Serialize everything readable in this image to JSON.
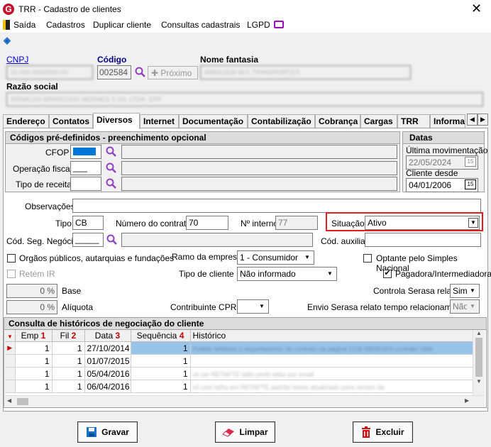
{
  "window": {
    "title": "TRR - Cadastro de clientes",
    "close_glyph": "✕"
  },
  "menu": {
    "items": [
      "Saída",
      "Cadastros",
      "Duplicar cliente",
      "Consultas cadastrais",
      "LGPD"
    ]
  },
  "header": {
    "cnpj_label": "CNPJ",
    "codigo_label": "Código",
    "codigo_value": "002584",
    "proximo_label": "Próximo",
    "nome_fantasia_label": "Nome fantasia",
    "razao_social_label": "Razão social"
  },
  "tabs": [
    "Endereço",
    "Contatos",
    "Diversos",
    "Internet",
    "Documentação",
    "Contabilização",
    "Cobrança",
    "Cargas",
    "TRR",
    "Informa"
  ],
  "active_tab": "Diversos",
  "codigos": {
    "title": "Códigos pré-definidos - preenchimento opcional",
    "cfop_label": "CFOP",
    "operacao_label": "Operação fiscal",
    "operacao_value": "___",
    "tipo_receita_label": "Tipo de receita"
  },
  "datas": {
    "title": "Datas",
    "ultima_label": "Última movimentação",
    "ultima_value": "22/05/2024",
    "cliente_desde_label": "Cliente desde",
    "cliente_desde_value": "04/01/2006",
    "cal_glyph": "15"
  },
  "form": {
    "observacoes_label": "Observações",
    "tipo_label": "Tipo",
    "tipo_value": "CB",
    "numero_contrato_label": "Número do contrato",
    "numero_contrato_value": "70",
    "n_interno_label": "Nº interno",
    "n_interno_value": "77",
    "situacao_label": "Situação",
    "situacao_value": "Ativo",
    "cod_seg_label": "Cód. Seg. Negócio",
    "cod_seg_value": "_____",
    "cod_auxiliar_label": "Cód. auxiliar",
    "orgaos_label": "Orgãos públicos, autarquias e fundações",
    "ramo_label": "Ramo da empresa",
    "ramo_value": "1 - Consumidor",
    "optante_label": "Optante pelo Simples Nacional",
    "retem_ir_label": "Retém IR",
    "tipo_cliente_label": "Tipo de cliente",
    "tipo_cliente_value": "Não informado",
    "pagadora_label": "Pagadora/Intermediadora",
    "base_value": "0 %",
    "base_label": "Base",
    "controla_serasa_label": "Controla Serasa relato",
    "controla_serasa_value": "Sim",
    "aliquota_value": "0 %",
    "aliquota_label": "Alíquota",
    "cprb_label": "Contribuinte CPRB",
    "envio_serasa_label": "Envio Serasa relato tempo relacionamento",
    "envio_serasa_value": "Não"
  },
  "historico": {
    "title": "Consulta de históricos de negociação do cliente",
    "columns": [
      "Emp",
      "Fil",
      "Data",
      "Sequência",
      "Histórico"
    ],
    "sort_indices": [
      "1",
      "2",
      "3",
      "4"
    ],
    "rows": [
      {
        "emp": "1",
        "fil": "1",
        "data": "27/10/2014",
        "seq": "1"
      },
      {
        "emp": "1",
        "fil": "1",
        "data": "01/07/2015",
        "seq": "1"
      },
      {
        "emp": "1",
        "fil": "1",
        "data": "05/04/2016",
        "seq": "1"
      },
      {
        "emp": "1",
        "fil": "1",
        "data": "06/04/2016",
        "seq": "1"
      }
    ]
  },
  "buttons": {
    "gravar": "Gravar",
    "limpar": "Limpar",
    "excluir": "Excluir"
  },
  "colors": {
    "accent": "#0078d7",
    "highlight_border": "#e02020",
    "tab_active": "#ffffff"
  }
}
